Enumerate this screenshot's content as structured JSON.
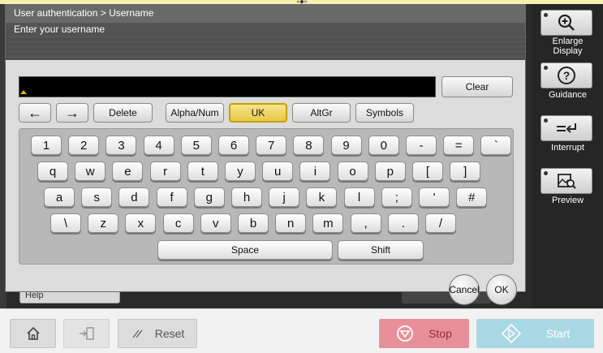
{
  "dialog": {
    "breadcrumb": "User authentication > Username",
    "prompt": "Enter your username",
    "entry_value": ""
  },
  "controls": {
    "clear": "Clear",
    "left_arrow": "←",
    "right_arrow": "→",
    "delete": "Delete",
    "alpha_num": "Alpha/Num",
    "uk": "UK",
    "altgr": "AltGr",
    "symbols": "Symbols"
  },
  "keyboard": {
    "row1": [
      "1",
      "2",
      "3",
      "4",
      "5",
      "6",
      "7",
      "8",
      "9",
      "0",
      "-",
      "=",
      "`"
    ],
    "row2": [
      "q",
      "w",
      "e",
      "r",
      "t",
      "y",
      "u",
      "i",
      "o",
      "p",
      "[",
      "]"
    ],
    "row3": [
      "a",
      "s",
      "d",
      "f",
      "g",
      "h",
      "j",
      "k",
      "l",
      ";",
      "'",
      "#"
    ],
    "row4": [
      "\\",
      "z",
      "x",
      "c",
      "v",
      "b",
      "n",
      "m",
      ",",
      ".",
      "/"
    ],
    "space": "Space",
    "shift": "Shift"
  },
  "actions": {
    "cancel": "Cancel",
    "ok": "OK"
  },
  "background": {
    "help": "Help"
  },
  "side_panel": {
    "enlarge": "Enlarge\nDisplay",
    "guidance": "Guidance",
    "interrupt": "Interrupt",
    "preview": "Preview"
  },
  "bottom_bar": {
    "reset": "Reset",
    "stop": "Stop",
    "start": "Start"
  },
  "colors": {
    "selected_key": "#e8c84a",
    "stop": "#e8909a",
    "start": "#a8d8e4"
  },
  "icons": {
    "enlarge": "magnifier-plus-icon",
    "guidance": "question-icon",
    "interrupt": "interrupt-icon",
    "preview": "preview-icon",
    "home": "home-icon",
    "logout": "logout-icon",
    "reset": "reset-icon",
    "stop": "stop-icon",
    "start": "start-icon"
  }
}
